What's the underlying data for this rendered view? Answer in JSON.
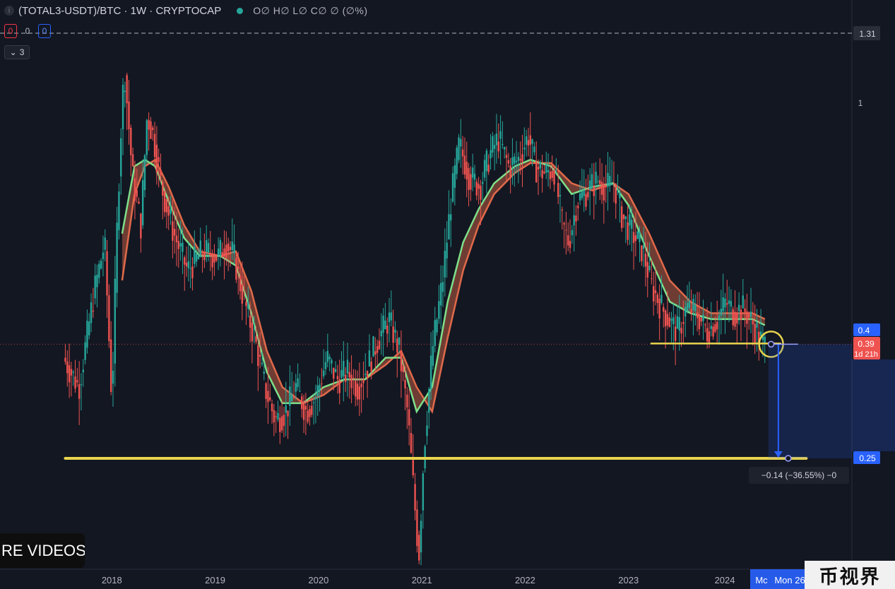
{
  "header": {
    "icon": "symbol-logo-icon",
    "title": "(TOTAL3-USDT)/BTC · 1W · CRYPTOCAP",
    "status_color": "#26a69a",
    "ohlc": "O∅ H∅ L∅ C∅ ∅ (∅%)"
  },
  "badges": {
    "sell": "0",
    "spread": "0",
    "buy": "0"
  },
  "collapse": {
    "icon": "chevron-down-icon",
    "count": "3"
  },
  "chart_data": {
    "type": "candlestick",
    "symbol": "(TOTAL3-USDT)/BTC",
    "interval": "1W",
    "y_scale": "log",
    "ylim": [
      0.1,
      1.31
    ],
    "x_axis_labels": [
      "2018",
      "2019",
      "2020",
      "2021",
      "2022",
      "2023",
      "2024",
      "Mon 26"
    ],
    "x_cursor_tag": "Mc",
    "y_axis_labels": [
      "1.31",
      "1",
      "0.4",
      "0.39",
      "0.25"
    ],
    "current_price": "0.39",
    "current_price_countdown": "1d 21h",
    "horizontal_line_top": 1.31,
    "colors": {
      "up": "#26a69a",
      "down": "#ef5350",
      "ma_fast": "#7ee08a",
      "ma_slow": "#e06a4a",
      "support": "#e8d44d",
      "measure": "#2962ff"
    },
    "price_series": [
      {
        "t": 2017.55,
        "v": 0.37
      },
      {
        "t": 2017.7,
        "v": 0.33
      },
      {
        "t": 2017.85,
        "v": 0.48
      },
      {
        "t": 2017.95,
        "v": 0.58
      },
      {
        "t": 2018.02,
        "v": 0.31
      },
      {
        "t": 2018.06,
        "v": 0.55
      },
      {
        "t": 2018.1,
        "v": 0.85
      },
      {
        "t": 2018.14,
        "v": 1.15
      },
      {
        "t": 2018.22,
        "v": 0.75
      },
      {
        "t": 2018.3,
        "v": 0.62
      },
      {
        "t": 2018.36,
        "v": 0.95
      },
      {
        "t": 2018.42,
        "v": 0.88
      },
      {
        "t": 2018.5,
        "v": 0.72
      },
      {
        "t": 2018.62,
        "v": 0.6
      },
      {
        "t": 2018.75,
        "v": 0.52
      },
      {
        "t": 2018.9,
        "v": 0.56
      },
      {
        "t": 2019.05,
        "v": 0.55
      },
      {
        "t": 2019.12,
        "v": 0.58
      },
      {
        "t": 2019.2,
        "v": 0.55
      },
      {
        "t": 2019.3,
        "v": 0.46
      },
      {
        "t": 2019.4,
        "v": 0.4
      },
      {
        "t": 2019.5,
        "v": 0.33
      },
      {
        "t": 2019.6,
        "v": 0.29
      },
      {
        "t": 2019.7,
        "v": 0.3
      },
      {
        "t": 2019.8,
        "v": 0.33
      },
      {
        "t": 2019.9,
        "v": 0.3
      },
      {
        "t": 2020.0,
        "v": 0.32
      },
      {
        "t": 2020.1,
        "v": 0.37
      },
      {
        "t": 2020.2,
        "v": 0.34
      },
      {
        "t": 2020.3,
        "v": 0.35
      },
      {
        "t": 2020.4,
        "v": 0.33
      },
      {
        "t": 2020.5,
        "v": 0.36
      },
      {
        "t": 2020.6,
        "v": 0.4
      },
      {
        "t": 2020.7,
        "v": 0.43
      },
      {
        "t": 2020.8,
        "v": 0.38
      },
      {
        "t": 2020.88,
        "v": 0.3
      },
      {
        "t": 2020.94,
        "v": 0.22
      },
      {
        "t": 2020.99,
        "v": 0.17
      },
      {
        "t": 2021.04,
        "v": 0.26
      },
      {
        "t": 2021.12,
        "v": 0.38
      },
      {
        "t": 2021.22,
        "v": 0.5
      },
      {
        "t": 2021.3,
        "v": 0.68
      },
      {
        "t": 2021.38,
        "v": 0.85
      },
      {
        "t": 2021.48,
        "v": 0.75
      },
      {
        "t": 2021.58,
        "v": 0.72
      },
      {
        "t": 2021.68,
        "v": 0.82
      },
      {
        "t": 2021.76,
        "v": 0.87
      },
      {
        "t": 2021.86,
        "v": 0.78
      },
      {
        "t": 2021.95,
        "v": 0.8
      },
      {
        "t": 2022.05,
        "v": 0.88
      },
      {
        "t": 2022.12,
        "v": 0.78
      },
      {
        "t": 2022.2,
        "v": 0.76
      },
      {
        "t": 2022.3,
        "v": 0.77
      },
      {
        "t": 2022.38,
        "v": 0.62
      },
      {
        "t": 2022.44,
        "v": 0.58
      },
      {
        "t": 2022.52,
        "v": 0.68
      },
      {
        "t": 2022.62,
        "v": 0.71
      },
      {
        "t": 2022.72,
        "v": 0.74
      },
      {
        "t": 2022.8,
        "v": 0.72
      },
      {
        "t": 2022.88,
        "v": 0.73
      },
      {
        "t": 2022.96,
        "v": 0.64
      },
      {
        "t": 2023.06,
        "v": 0.6
      },
      {
        "t": 2023.16,
        "v": 0.56
      },
      {
        "t": 2023.24,
        "v": 0.49
      },
      {
        "t": 2023.34,
        "v": 0.45
      },
      {
        "t": 2023.44,
        "v": 0.42
      },
      {
        "t": 2023.5,
        "v": 0.41
      },
      {
        "t": 2023.58,
        "v": 0.45
      },
      {
        "t": 2023.68,
        "v": 0.44
      },
      {
        "t": 2023.78,
        "v": 0.41
      },
      {
        "t": 2023.88,
        "v": 0.43
      },
      {
        "t": 2023.96,
        "v": 0.46
      },
      {
        "t": 2024.04,
        "v": 0.44
      },
      {
        "t": 2024.12,
        "v": 0.45
      },
      {
        "t": 2024.2,
        "v": 0.43
      },
      {
        "t": 2024.26,
        "v": 0.41
      },
      {
        "t": 2024.32,
        "v": 0.39
      }
    ],
    "ma_fast": [
      {
        "t": 2018.1,
        "v": 0.6
      },
      {
        "t": 2018.22,
        "v": 0.78
      },
      {
        "t": 2018.32,
        "v": 0.8
      },
      {
        "t": 2018.42,
        "v": 0.78
      },
      {
        "t": 2018.55,
        "v": 0.68
      },
      {
        "t": 2018.7,
        "v": 0.59
      },
      {
        "t": 2018.85,
        "v": 0.55
      },
      {
        "t": 2019.05,
        "v": 0.55
      },
      {
        "t": 2019.2,
        "v": 0.53
      },
      {
        "t": 2019.35,
        "v": 0.44
      },
      {
        "t": 2019.5,
        "v": 0.35
      },
      {
        "t": 2019.65,
        "v": 0.31
      },
      {
        "t": 2019.85,
        "v": 0.31
      },
      {
        "t": 2020.05,
        "v": 0.33
      },
      {
        "t": 2020.25,
        "v": 0.34
      },
      {
        "t": 2020.45,
        "v": 0.34
      },
      {
        "t": 2020.65,
        "v": 0.37
      },
      {
        "t": 2020.8,
        "v": 0.37
      },
      {
        "t": 2020.95,
        "v": 0.3
      },
      {
        "t": 2021.1,
        "v": 0.33
      },
      {
        "t": 2021.25,
        "v": 0.46
      },
      {
        "t": 2021.4,
        "v": 0.58
      },
      {
        "t": 2021.55,
        "v": 0.66
      },
      {
        "t": 2021.7,
        "v": 0.73
      },
      {
        "t": 2021.9,
        "v": 0.78
      },
      {
        "t": 2022.05,
        "v": 0.8
      },
      {
        "t": 2022.25,
        "v": 0.78
      },
      {
        "t": 2022.45,
        "v": 0.7
      },
      {
        "t": 2022.65,
        "v": 0.72
      },
      {
        "t": 2022.85,
        "v": 0.73
      },
      {
        "t": 2023.0,
        "v": 0.67
      },
      {
        "t": 2023.2,
        "v": 0.55
      },
      {
        "t": 2023.4,
        "v": 0.46
      },
      {
        "t": 2023.6,
        "v": 0.44
      },
      {
        "t": 2023.8,
        "v": 0.43
      },
      {
        "t": 2024.0,
        "v": 0.43
      },
      {
        "t": 2024.2,
        "v": 0.43
      },
      {
        "t": 2024.32,
        "v": 0.42
      }
    ],
    "ma_slow": [
      {
        "t": 2018.1,
        "v": 0.5
      },
      {
        "t": 2018.22,
        "v": 0.7
      },
      {
        "t": 2018.32,
        "v": 0.78
      },
      {
        "t": 2018.42,
        "v": 0.8
      },
      {
        "t": 2018.55,
        "v": 0.72
      },
      {
        "t": 2018.7,
        "v": 0.62
      },
      {
        "t": 2018.85,
        "v": 0.56
      },
      {
        "t": 2019.05,
        "v": 0.55
      },
      {
        "t": 2019.2,
        "v": 0.56
      },
      {
        "t": 2019.35,
        "v": 0.48
      },
      {
        "t": 2019.5,
        "v": 0.38
      },
      {
        "t": 2019.65,
        "v": 0.33
      },
      {
        "t": 2019.85,
        "v": 0.31
      },
      {
        "t": 2020.05,
        "v": 0.32
      },
      {
        "t": 2020.25,
        "v": 0.34
      },
      {
        "t": 2020.45,
        "v": 0.34
      },
      {
        "t": 2020.65,
        "v": 0.36
      },
      {
        "t": 2020.8,
        "v": 0.38
      },
      {
        "t": 2020.95,
        "v": 0.33
      },
      {
        "t": 2021.1,
        "v": 0.3
      },
      {
        "t": 2021.25,
        "v": 0.4
      },
      {
        "t": 2021.4,
        "v": 0.52
      },
      {
        "t": 2021.55,
        "v": 0.62
      },
      {
        "t": 2021.7,
        "v": 0.7
      },
      {
        "t": 2021.9,
        "v": 0.76
      },
      {
        "t": 2022.05,
        "v": 0.79
      },
      {
        "t": 2022.25,
        "v": 0.79
      },
      {
        "t": 2022.45,
        "v": 0.73
      },
      {
        "t": 2022.65,
        "v": 0.71
      },
      {
        "t": 2022.85,
        "v": 0.73
      },
      {
        "t": 2023.0,
        "v": 0.7
      },
      {
        "t": 2023.2,
        "v": 0.6
      },
      {
        "t": 2023.4,
        "v": 0.5
      },
      {
        "t": 2023.6,
        "v": 0.46
      },
      {
        "t": 2023.8,
        "v": 0.44
      },
      {
        "t": 2024.0,
        "v": 0.44
      },
      {
        "t": 2024.2,
        "v": 0.44
      },
      {
        "t": 2024.32,
        "v": 0.43
      }
    ],
    "annotations": {
      "support_low": {
        "value": 0.25,
        "t_start": 2017.55,
        "t_end": 2024.72
      },
      "support_high": {
        "value": 0.39,
        "t_start": 2023.22,
        "t_end": 2024.47
      },
      "circle_marker": {
        "t": 2024.38,
        "value": 0.39
      },
      "measure": {
        "from_value": 0.39,
        "to_value": 0.25,
        "t": 2024.45,
        "label": "−0.14 (−36.55%) −0"
      }
    }
  },
  "overlay": {
    "yt_button": "RE VIDEOS",
    "watermark": "币视界"
  }
}
